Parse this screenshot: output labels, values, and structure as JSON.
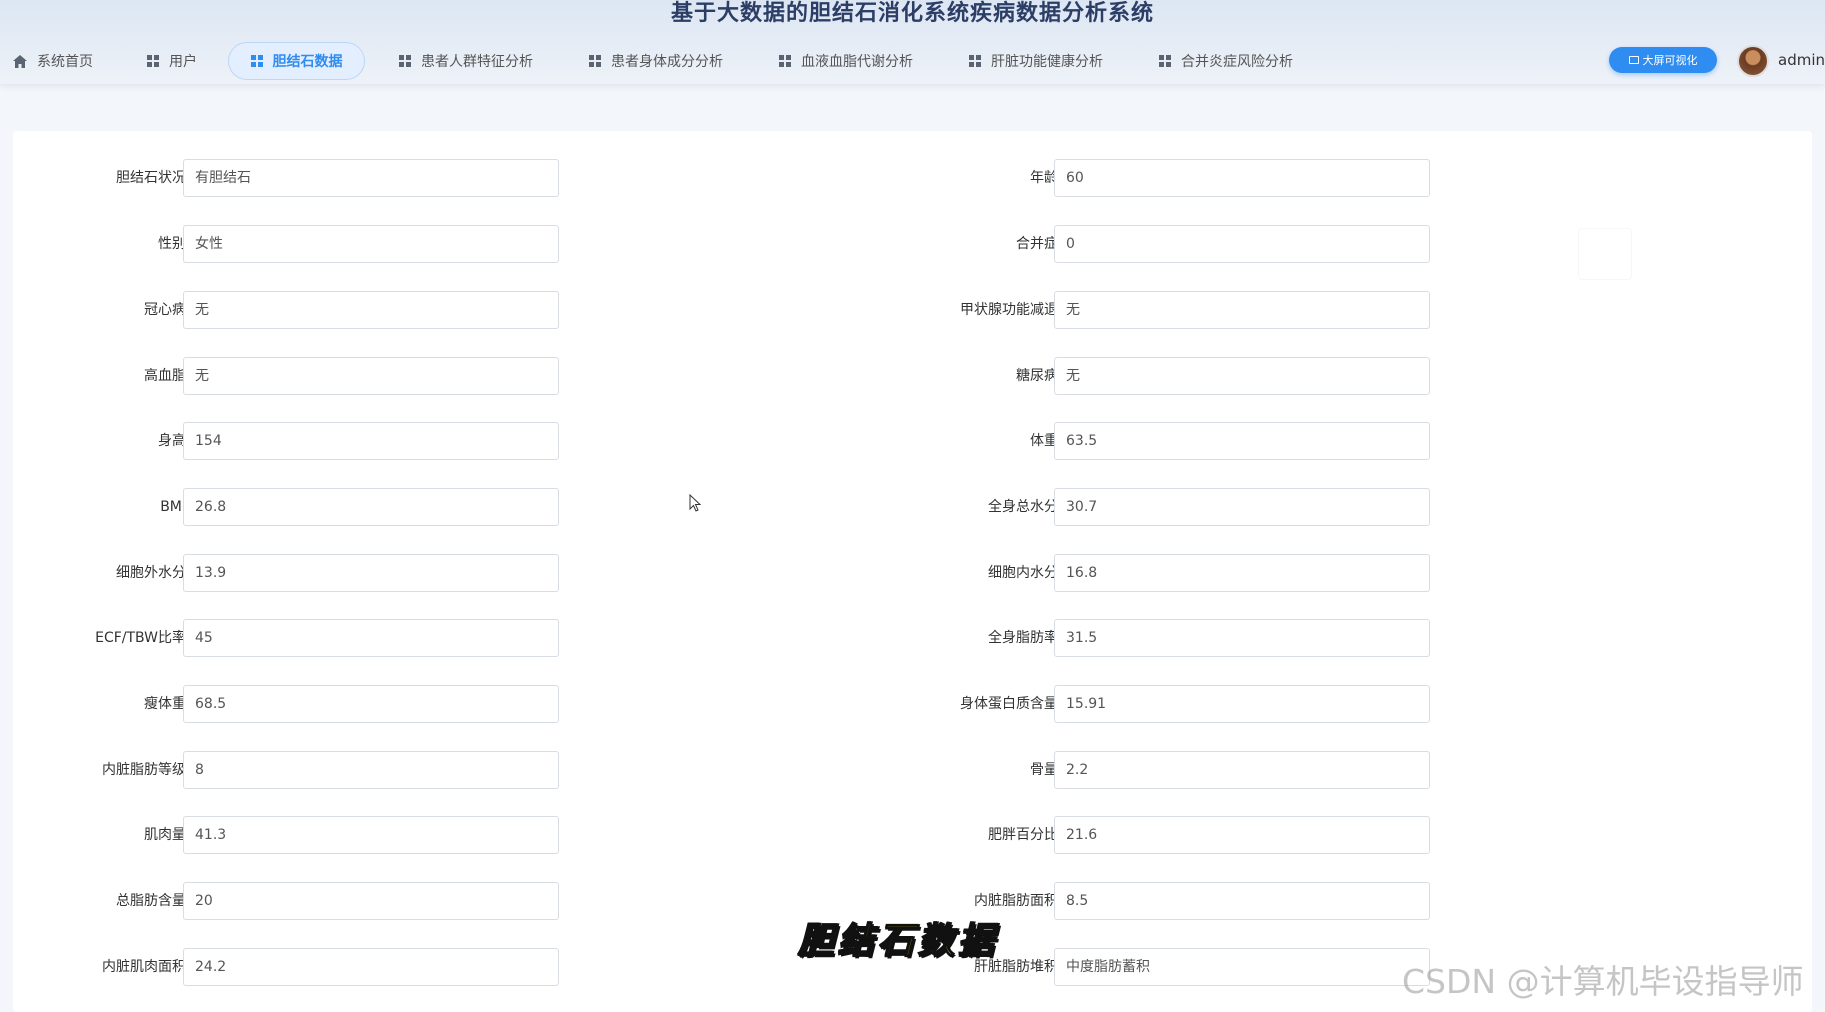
{
  "header": {
    "title": "基于大数据的胆结石消化系统疾病数据分析系统",
    "nav": [
      {
        "label": "系统首页",
        "icon": "home-icon"
      },
      {
        "label": "用户",
        "icon": "grid-icon"
      },
      {
        "label": "胆结石数据",
        "icon": "grid-icon",
        "active": true
      },
      {
        "label": "患者人群特征分析",
        "icon": "grid-icon"
      },
      {
        "label": "患者身体成分分析",
        "icon": "grid-icon"
      },
      {
        "label": "血液血脂代谢分析",
        "icon": "grid-icon"
      },
      {
        "label": "肝脏功能健康分析",
        "icon": "grid-icon"
      },
      {
        "label": "合并炎症风险分析",
        "icon": "grid-icon"
      }
    ],
    "bigscreen_label": "大屏可视化",
    "username": "admin"
  },
  "form": {
    "left": [
      {
        "label": "胆结石状况",
        "value": "有胆结石"
      },
      {
        "label": "性别",
        "value": "女性"
      },
      {
        "label": "冠心病",
        "value": "无"
      },
      {
        "label": "高血脂",
        "value": "无"
      },
      {
        "label": "身高",
        "value": "154"
      },
      {
        "label": "BMI",
        "value": "26.8"
      },
      {
        "label": "细胞外水分",
        "value": "13.9"
      },
      {
        "label": "ECF/TBW比率",
        "value": "45"
      },
      {
        "label": "瘦体重",
        "value": "68.5"
      },
      {
        "label": "内脏脂肪等级",
        "value": "8"
      },
      {
        "label": "肌肉量",
        "value": "41.3"
      },
      {
        "label": "总脂肪含量",
        "value": "20"
      },
      {
        "label": "内脏肌肉面积",
        "value": "24.2"
      }
    ],
    "right": [
      {
        "label": "年龄",
        "value": "60"
      },
      {
        "label": "合并症",
        "value": "0"
      },
      {
        "label": "甲状腺功能减退",
        "value": "无"
      },
      {
        "label": "糖尿病",
        "value": "无"
      },
      {
        "label": "体重",
        "value": "63.5"
      },
      {
        "label": "全身总水分",
        "value": "30.7"
      },
      {
        "label": "细胞内水分",
        "value": "16.8"
      },
      {
        "label": "全身脂肪率",
        "value": "31.5"
      },
      {
        "label": "身体蛋白质含量",
        "value": "15.91"
      },
      {
        "label": "骨量",
        "value": "2.2"
      },
      {
        "label": "肥胖百分比",
        "value": "21.6"
      },
      {
        "label": "内脏脂肪面积",
        "value": "8.5"
      },
      {
        "label": "肝脏脂肪堆积",
        "value": "中度脂肪蓄积"
      }
    ]
  },
  "overlay": {
    "caption": "胆结石数据",
    "watermark": "CSDN @计算机毕设指导师"
  },
  "colors": {
    "accent": "#2f8cf0",
    "title": "#2c3e66",
    "caption": "#ffd400"
  }
}
